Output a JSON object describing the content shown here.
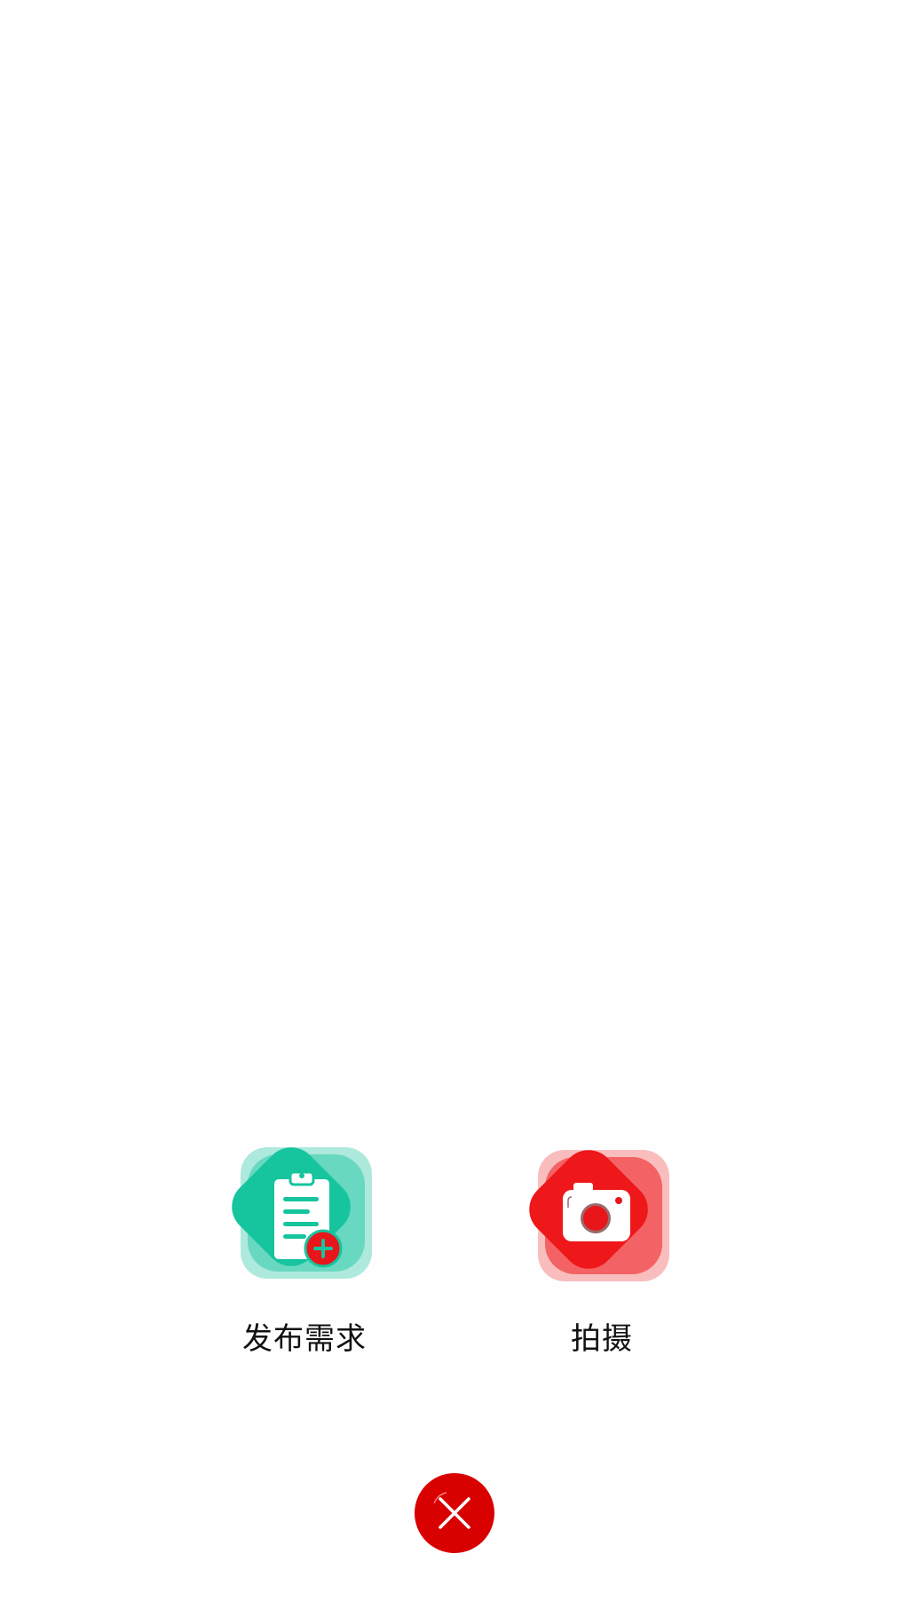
{
  "actions": [
    {
      "label": "发布需求",
      "icon": "clipboard-add-icon",
      "color": "#16c49e",
      "badge_color": "#e8161b"
    },
    {
      "label": "拍摄",
      "icon": "camera-icon",
      "color": "#ee1719",
      "lens_color": "#e8161b"
    }
  ],
  "close": {
    "icon": "close-icon",
    "color": "#d90000"
  }
}
